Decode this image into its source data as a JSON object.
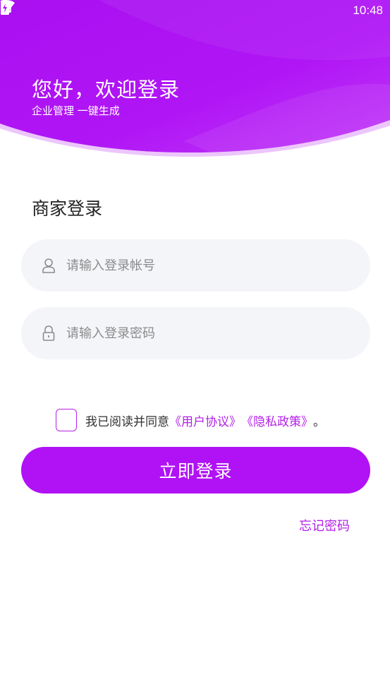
{
  "status_bar": {
    "time": "10:48",
    "icons": [
      "wifi-icon",
      "no-sim-icon",
      "battery-charging-icon"
    ]
  },
  "header": {
    "greeting": "您好，欢迎登录",
    "subtitle": "企业管理 一键生成",
    "colors": {
      "primary": "#b012f5",
      "light": "#c94cf7"
    }
  },
  "form": {
    "title": "商家登录",
    "account": {
      "placeholder": "请输入登录帐号",
      "value": "",
      "icon": "user-icon"
    },
    "password": {
      "placeholder": "请输入登录密码",
      "value": "",
      "icon": "lock-icon"
    }
  },
  "agreement": {
    "checked": false,
    "prefix": "我已阅读并同意",
    "user_agreement": "《用户协议》",
    "privacy_policy": "《隐私政策》",
    "suffix": "。"
  },
  "login_button": "立即登录",
  "forgot_password": "忘记密码"
}
